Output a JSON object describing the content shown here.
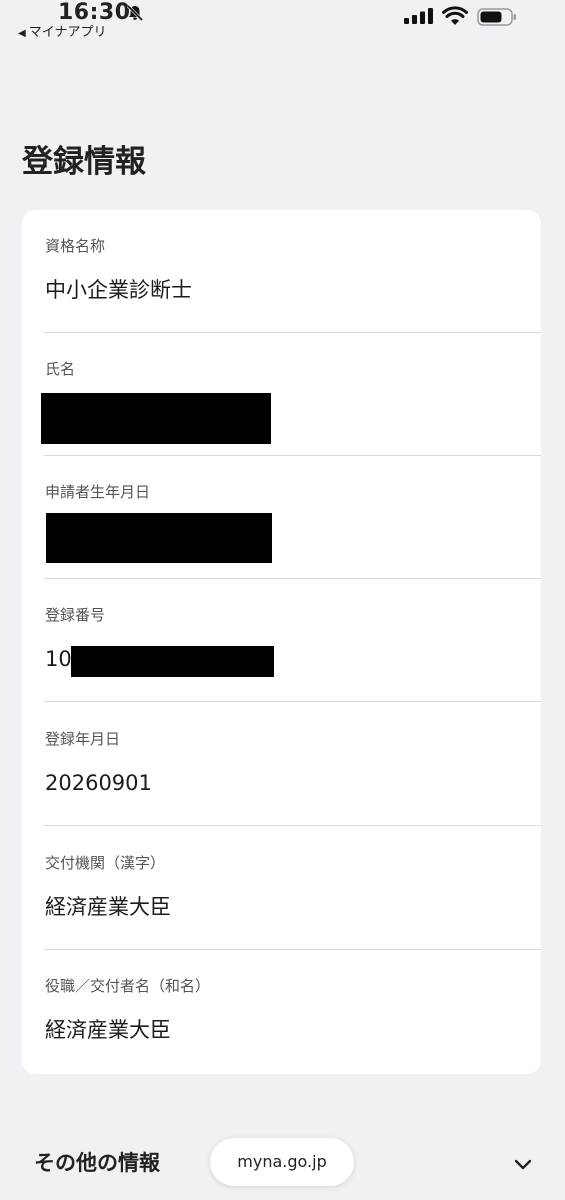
{
  "status_bar": {
    "time": "16:30",
    "back_app": "マイナアプリ",
    "icons": [
      "bell-muted-icon",
      "cellular-signal-icon",
      "wifi-icon",
      "battery-icon"
    ]
  },
  "page_title": "登録情報",
  "fields": [
    {
      "label": "資格名称",
      "value": "中小企業診断士"
    },
    {
      "label": "氏名",
      "value": ""
    },
    {
      "label": "申請者生年月日",
      "value": ""
    },
    {
      "label": "登録番号",
      "value": "10"
    },
    {
      "label": "登録年月日",
      "value": "20260901"
    },
    {
      "label": "交付機関（漢字）",
      "value": "経済産業大臣"
    },
    {
      "label": "役職／交付者名（和名）",
      "value": "経済産業大臣"
    }
  ],
  "other_info": {
    "label": "その他の情報",
    "icon": "chevron-down-icon"
  },
  "url_bar": {
    "url": "myna.go.jp"
  },
  "colors": {
    "background": "#f1f1f5",
    "card": "#ffffff",
    "redaction": "#000000",
    "divider": "#d9d9de"
  }
}
